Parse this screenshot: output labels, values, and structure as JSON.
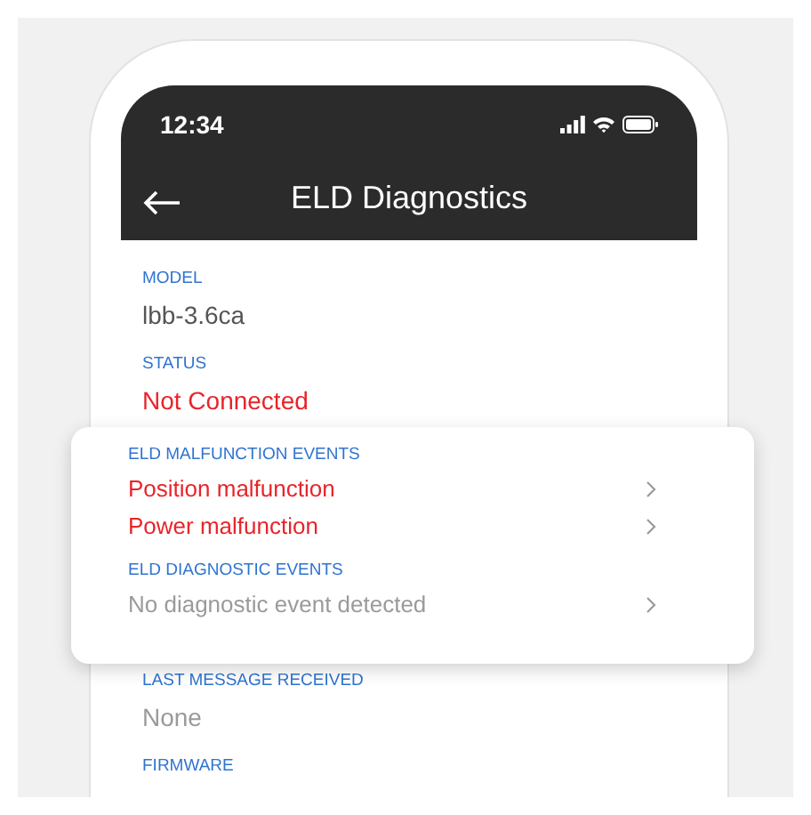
{
  "status_bar": {
    "time": "12:34"
  },
  "header": {
    "title": "ELD Diagnostics"
  },
  "fields": [
    {
      "label": "MODEL",
      "value": "lbb-3.6ca",
      "kind": "normal"
    },
    {
      "label": "STATUS",
      "value": "Not Connected",
      "kind": "alert"
    }
  ],
  "events_card": {
    "sections": [
      {
        "heading": "ELD MALFUNCTION EVENTS",
        "items": [
          {
            "text": "Position malfunction",
            "kind": "alert"
          },
          {
            "text": "Power malfunction",
            "kind": "alert"
          }
        ]
      },
      {
        "heading": "ELD DIAGNOSTIC EVENTS",
        "items": [
          {
            "text": "No diagnostic event detected",
            "kind": "muted"
          }
        ]
      }
    ]
  },
  "more_fields": [
    {
      "label": "LAST MESSAGE RECEIVED",
      "value": "None",
      "kind": "muted"
    },
    {
      "label": "FIRMWARE"
    }
  ]
}
